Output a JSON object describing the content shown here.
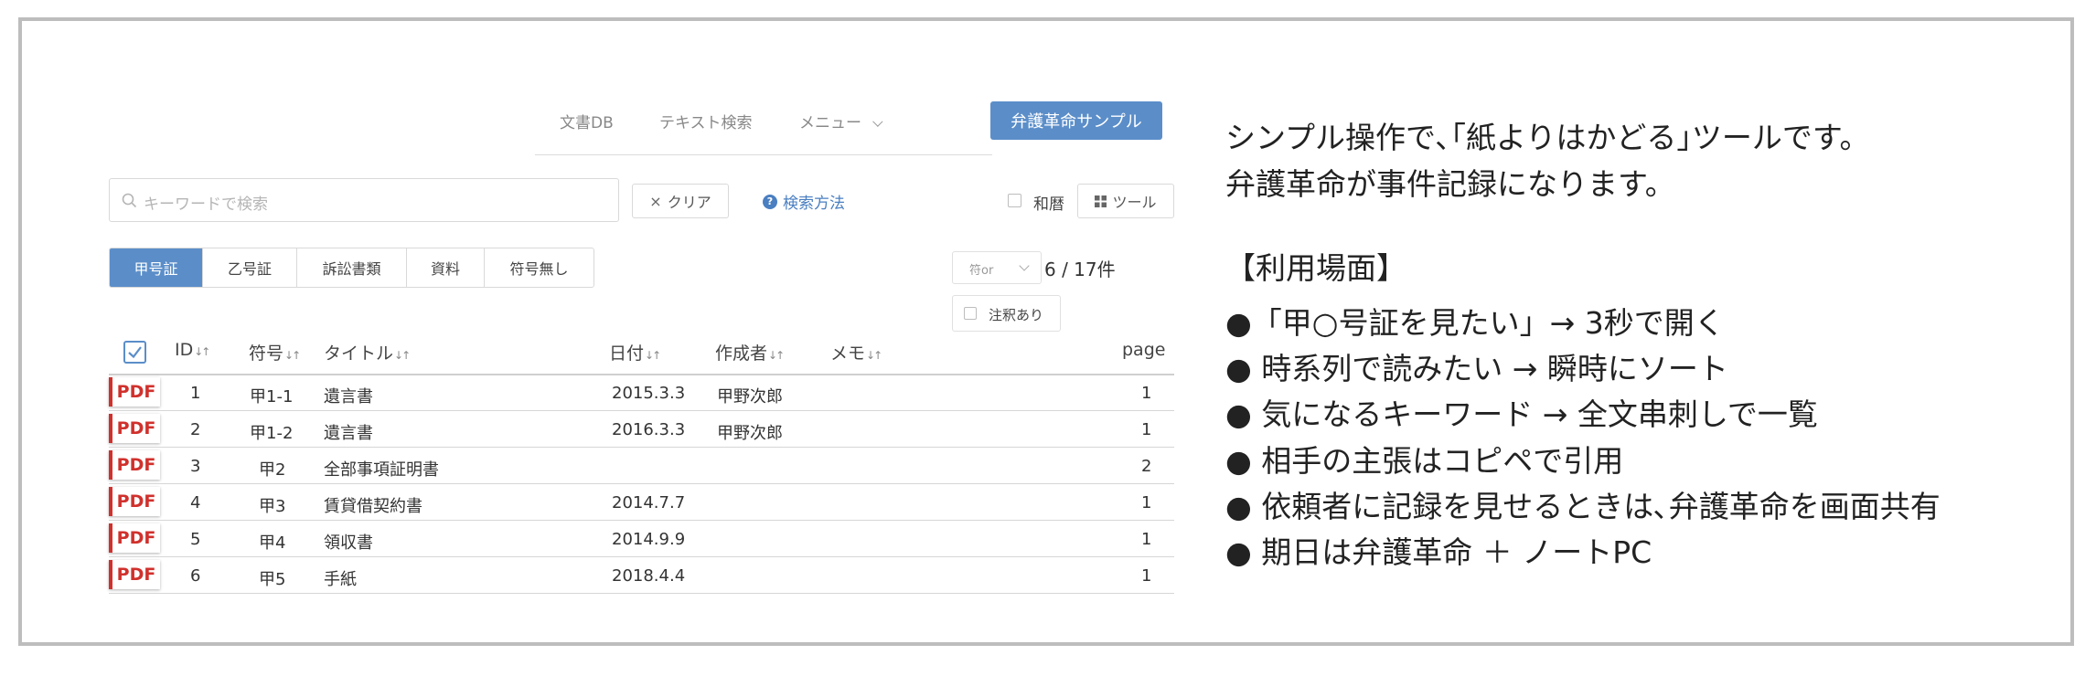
{
  "nav": {
    "items": [
      "文書DB",
      "テキスト検索",
      "メニュー"
    ],
    "sample_button": "弁護革命サンプル"
  },
  "search": {
    "placeholder": "キーワードで検索",
    "clear_label": "クリア",
    "help_label": "検索方法",
    "wareki_label": "和暦",
    "tool_label": "ツール"
  },
  "tabs": [
    "甲号証",
    "乙号証",
    "訴訟書類",
    "資料",
    "符号無し"
  ],
  "filter": {
    "select_value": "符or",
    "count": "6 / 17件",
    "annotated_label": "注釈あり"
  },
  "table": {
    "headers": {
      "id": "ID",
      "code": "符号",
      "title": "タイトル",
      "date": "日付",
      "author": "作成者",
      "memo": "メモ",
      "page": "page"
    },
    "pdf_label": "PDF",
    "rows": [
      {
        "id": "1",
        "code": "甲1-1",
        "title": "遺言書",
        "date": "2015.3.3",
        "author": "甲野次郎",
        "page": "1"
      },
      {
        "id": "2",
        "code": "甲1-2",
        "title": "遺言書",
        "date": "2016.3.3",
        "author": "甲野次郎",
        "page": "1"
      },
      {
        "id": "3",
        "code": "甲2",
        "title": "全部事項証明書",
        "date": "",
        "author": "",
        "page": "2"
      },
      {
        "id": "4",
        "code": "甲3",
        "title": "賃貸借契約書",
        "date": "2014.7.7",
        "author": "",
        "page": "1"
      },
      {
        "id": "5",
        "code": "甲4",
        "title": "領収書",
        "date": "2014.9.9",
        "author": "",
        "page": "1"
      },
      {
        "id": "6",
        "code": "甲5",
        "title": "手紙",
        "date": "2018.4.4",
        "author": "",
        "page": "1"
      }
    ]
  },
  "description": {
    "intro": [
      "シンプル操作で､｢紙よりはかどる｣ツールです。",
      "弁護革命が事件記録になります。"
    ],
    "section_title": "【利用場面】",
    "bullets": [
      "●「甲○号証を見たい」→ 3秒で開く",
      "● 時系列で読みたい → 瞬時にソート",
      "● 気になるキーワード → 全文串刺しで一覧",
      "● 相手の主張はコピペで引用",
      "● 依頼者に記録を見せるときは､弁護革命を画面共有",
      "● 期日は弁護革命 ＋ ノートPC"
    ]
  },
  "colors": {
    "accent": "#5b8ec9",
    "pdf_red": "#d0312d",
    "frame": "#bdbdbd"
  }
}
